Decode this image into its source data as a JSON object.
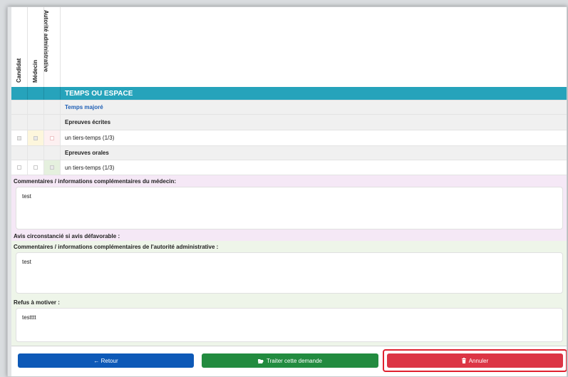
{
  "columns": [
    "Candidat",
    "Médecin",
    "Autorité administrative"
  ],
  "section": {
    "title": "TEMPS OU ESPACE"
  },
  "rows": {
    "subheading": "Temps majoré",
    "group1": "Epreuves écrites",
    "item1": "un tiers-temps (1/3)",
    "group2": "Epreuves orales",
    "item2": "un tiers-temps (1/3)"
  },
  "medecin": {
    "label": "Commentaires / informations complémentaires du médecin:",
    "value": "test",
    "avis_label": "Avis circonstancié si avis défavorable :"
  },
  "autorite": {
    "label": "Commentaires / informations complémentaires de l'autorité administrative :",
    "value": "test",
    "refus_label": "Refus à motiver :",
    "refus_value": "testttt"
  },
  "buttons": {
    "retour": "← Retour",
    "traiter": "Traiter cette demande",
    "annuler": "Annuler"
  },
  "colors": {
    "section": "#26a3bb",
    "retour": "#0d59b7",
    "traiter": "#228b3f",
    "annuler": "#dc3545",
    "highlight": "#e0212f"
  },
  "icons": {
    "traiter": "folder-open-icon",
    "annuler": "trash-icon"
  }
}
